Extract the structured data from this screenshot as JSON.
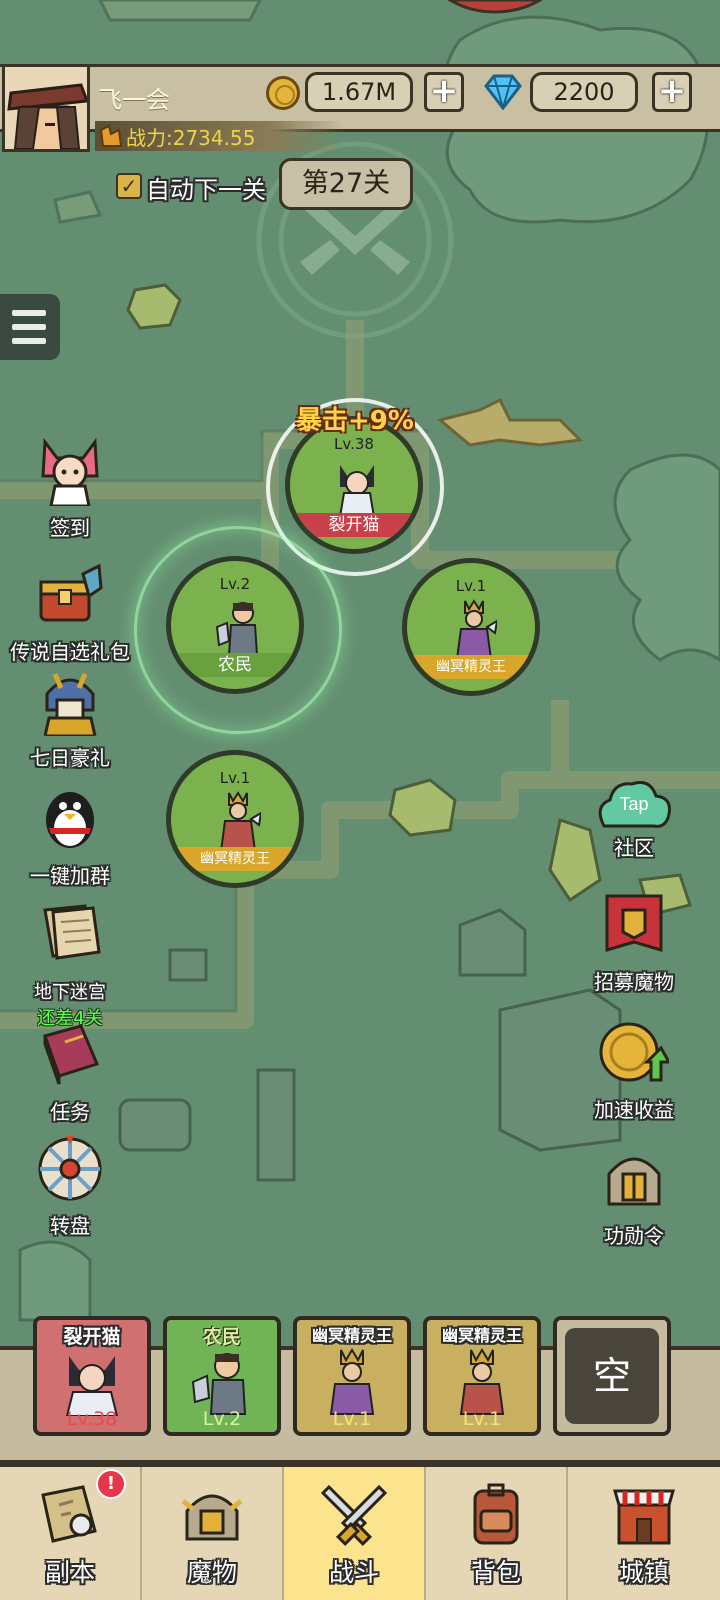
{
  "player": {
    "name": "飞一会",
    "power": "战力:2734.55"
  },
  "currency": {
    "gold": "1.67M",
    "gems": "2200",
    "plus": "+"
  },
  "stage": {
    "auto_next_label": "自动下一关",
    "auto_next_checked": true,
    "current": "第27关"
  },
  "crit_bonus": "暴击+9%",
  "side_left": [
    {
      "key": "signin",
      "label": "签到"
    },
    {
      "key": "legend_pack",
      "label": "传说自选礼包"
    },
    {
      "key": "seven_day",
      "label": "七日豪礼"
    },
    {
      "key": "join_group",
      "label": "一键加群"
    },
    {
      "key": "dungeon",
      "label": "地下迷宫",
      "sub": "还差4关"
    },
    {
      "key": "tasks",
      "label": "任务"
    },
    {
      "key": "wheel",
      "label": "转盘"
    }
  ],
  "side_right": [
    {
      "key": "community",
      "label": "社区",
      "badge": "Tap"
    },
    {
      "key": "recruit",
      "label": "招募魔物"
    },
    {
      "key": "speedup",
      "label": "加速收益"
    },
    {
      "key": "merit",
      "label": "功勋令"
    }
  ],
  "field_units": [
    {
      "name": "裂开猫",
      "level": "Lv.38"
    },
    {
      "name": "农民",
      "level": "Lv.2"
    },
    {
      "name": "幽冥精灵王",
      "level": "Lv.1"
    },
    {
      "name": "幽冥精灵王",
      "level": "Lv.1"
    }
  ],
  "team_slots": [
    {
      "name": "裂开猫",
      "level": "Lv.38"
    },
    {
      "name": "农民",
      "level": "Lv.2"
    },
    {
      "name": "幽冥精灵王",
      "level": "Lv.1"
    },
    {
      "name": "幽冥精灵王",
      "level": "Lv.1"
    },
    {
      "name": "",
      "level": "",
      "empty_label": "空"
    }
  ],
  "nav": [
    {
      "label": "副本",
      "badge": "!"
    },
    {
      "label": "魔物"
    },
    {
      "label": "战斗",
      "active": true
    },
    {
      "label": "背包"
    },
    {
      "label": "城镇"
    }
  ],
  "colors": {
    "active_tab": "#fce48f",
    "gem": "#4fc3f7",
    "gold": "#e5b43a",
    "dungeon_sub": "#5bff4d"
  }
}
